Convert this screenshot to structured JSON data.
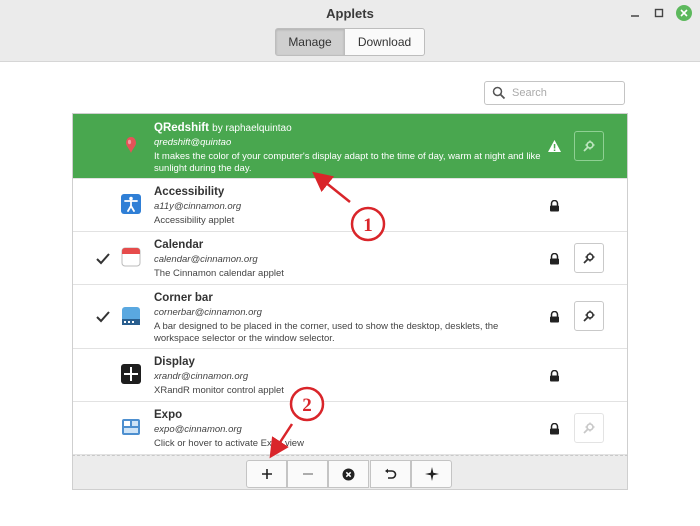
{
  "window": {
    "title": "Applets"
  },
  "tabs": [
    {
      "label": "Manage",
      "active": true
    },
    {
      "label": "Download",
      "active": false
    }
  ],
  "search": {
    "placeholder": "Search"
  },
  "applets": [
    {
      "name": "QRedshift",
      "author": "by raphaelquintao",
      "uuid": "qredshift@quintao",
      "description": "It makes the color of your computer's display adapt to the time of day, warm at night and like sunlight during the day.",
      "enabled": false,
      "status_icon": "warning-icon",
      "configurable": true,
      "selected": true
    },
    {
      "name": "Accessibility",
      "author": "",
      "uuid": "a11y@cinnamon.org",
      "description": "Accessibility applet",
      "enabled": false,
      "status_icon": "lock-icon",
      "configurable": false,
      "selected": false
    },
    {
      "name": "Calendar",
      "author": "",
      "uuid": "calendar@cinnamon.org",
      "description": "The Cinnamon calendar applet",
      "enabled": true,
      "status_icon": "lock-icon",
      "configurable": true,
      "selected": false
    },
    {
      "name": "Corner bar",
      "author": "",
      "uuid": "cornerbar@cinnamon.org",
      "description": "A bar designed to be placed in the corner, used to show the desktop, desklets, the workspace selector or the window selector.",
      "enabled": true,
      "status_icon": "lock-icon",
      "configurable": true,
      "selected": false
    },
    {
      "name": "Display",
      "author": "",
      "uuid": "xrandr@cinnamon.org",
      "description": "XRandR monitor control applet",
      "enabled": false,
      "status_icon": "lock-icon",
      "configurable": false,
      "selected": false
    },
    {
      "name": "Expo",
      "author": "",
      "uuid": "expo@cinnamon.org",
      "description": "Click or hover to activate Expo view",
      "enabled": false,
      "status_icon": "lock-icon",
      "configurable": true,
      "config_disabled": true,
      "selected": false
    }
  ],
  "toolbar": {
    "icons": [
      "add-icon",
      "remove-icon",
      "clear-icon",
      "undo-icon",
      "more-icon"
    ]
  },
  "annotations": [
    {
      "label": "1"
    },
    {
      "label": "2"
    }
  ],
  "colors": {
    "selected_row": "#49a74f",
    "annotation": "#d9252a",
    "close_button": "#5cb85c"
  }
}
